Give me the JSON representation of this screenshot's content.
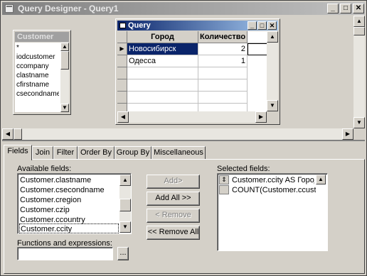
{
  "window": {
    "title": "Query Designer - Query1",
    "min_label": "_",
    "max_label": "□",
    "close_label": "✕"
  },
  "customer_table": {
    "title": "Customer",
    "fields": [
      "*",
      "iodcustomer",
      "ccompany",
      "clastname",
      "cfirstname",
      "csecondname"
    ]
  },
  "query_window": {
    "title": "Query",
    "min_label": "_",
    "max_label": "□",
    "close_label": "✕",
    "columns": [
      "Город",
      "Количество"
    ],
    "rows": [
      {
        "city": "Новосибирск",
        "count": "2"
      },
      {
        "city": "Одесса",
        "count": "1"
      }
    ]
  },
  "tabs": [
    "Fields",
    "Join",
    "Filter",
    "Order By",
    "Group By",
    "Miscellaneous"
  ],
  "active_tab": "Fields",
  "fields_tab": {
    "available_label": "Available fields:",
    "available_fields": [
      "Customer.clastname",
      "Customer.csecondname",
      "Customer.cregion",
      "Customer.czip",
      "Customer.ccountry",
      "Customer.ccity"
    ],
    "selected_available": "Customer.ccity",
    "add_label": "Add>",
    "add_all_label": "Add All >>",
    "remove_label": "< Remove",
    "remove_all_label": "<< Remove All",
    "selected_label": "Selected fields:",
    "selected_fields": [
      "Customer.ccity AS Город",
      "COUNT(Customer.ccustid"
    ],
    "functions_label": "Functions and expressions:",
    "functions_value": "",
    "browse_label": "..."
  },
  "icons": {
    "scroll_up": "arrow-up-icon",
    "scroll_down": "arrow-down-icon",
    "scroll_left": "arrow-left-icon",
    "scroll_right": "arrow-right-icon",
    "row_pointer": "row-pointer-icon",
    "move_handle": "up-down-handle-icon"
  }
}
